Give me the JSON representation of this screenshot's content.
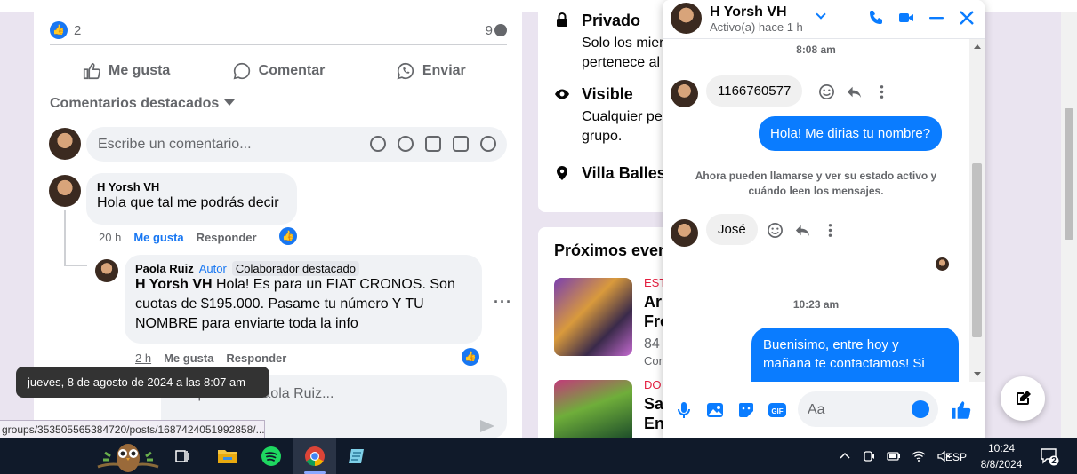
{
  "post": {
    "like_count": "2",
    "comment_count": "9",
    "actions": {
      "like": "Me gusta",
      "comment": "Comentar",
      "send": "Enviar"
    },
    "featured_label": "Comentarios destacados",
    "comment_placeholder": "Escribe un comentario..."
  },
  "comments": [
    {
      "author": "H Yorsh VH",
      "text": "Hola que tal me podrás decir",
      "time": "20 h",
      "like_label": "Me gusta",
      "reply_label": "Responder"
    },
    {
      "author": "Paola Ruiz",
      "author_tag": "Autor",
      "collab_tag": "Colaborador destacado",
      "mention": "H Yorsh VH",
      "text_line1": " Hola! Es para un FIAT CRONOS. Son",
      "text_line2": "cuotas de $195.000. Pasame tu número Y TU",
      "text_line3": "NOMBRE para enviarte toda la info",
      "time": "2 h",
      "like_label": "Me gusta",
      "reply_label": "Responder"
    }
  ],
  "reply_placeholder": "Responde a Paola Ruiz...",
  "tooltip": "jueves, 8 de agosto de 2024 a las 8:07 am",
  "status_url": "groups/353505565384720/posts/1687424051992858/...",
  "group_info": {
    "privacy_title": "Privado",
    "privacy_sub1": "Solo los mier",
    "privacy_sub2": "pertenece al",
    "visible_title": "Visible",
    "visible_sub1": "Cualquier pe",
    "visible_sub2": "grupo.",
    "location": "Villa Balles",
    "events_title": "Próximos even",
    "event1": {
      "tag": "EST",
      "name1": "Ar",
      "name2": "Fre",
      "small1": "84",
      "small2": "Cor"
    },
    "event2": {
      "tag": "DO",
      "name1": "Sa",
      "name2": "En"
    }
  },
  "chat": {
    "name": "H Yorsh VH",
    "status": "Activo(a) hace 1 h",
    "messages": {
      "ts1": "8:08 am",
      "in1": "1166760577",
      "out1": "Hola! Me dirias tu nombre?",
      "system": "Ahora pueden llamarse y ver su estado activo y cuándo leen los mensajes.",
      "in2": "José",
      "ts2": "10:23 am",
      "out2_line1": "Buenisimo, entre hoy y",
      "out2_line2": "mañana te contactamos! Si"
    },
    "composer_placeholder": "Aa",
    "accent": "#0a7cff"
  },
  "taskbar": {
    "lang": "ESP",
    "time": "10:24",
    "date": "8/8/2024",
    "notifications": "2"
  }
}
